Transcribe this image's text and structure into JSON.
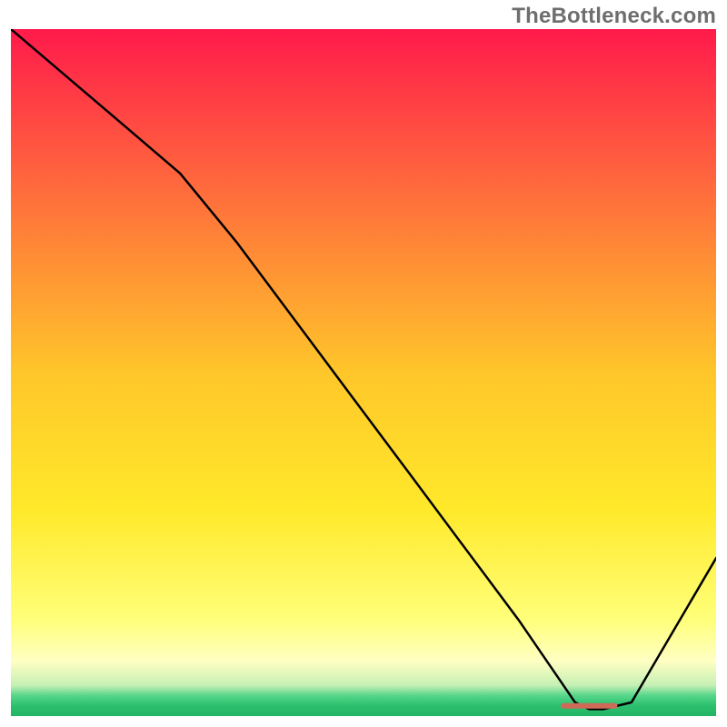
{
  "watermark_text": "TheBottleneck.com",
  "chart_data": {
    "type": "line",
    "title": "",
    "xlabel": "",
    "ylabel": "",
    "xlim": [
      0,
      100
    ],
    "ylim": [
      0,
      100
    ],
    "grid": false,
    "legend": false,
    "annotations": [
      {
        "text": "TheBottleneck.com",
        "position": "top-right"
      }
    ],
    "background": {
      "type": "vertical-gradient",
      "stops": [
        {
          "pos": 0.0,
          "color": "#ff1a4b"
        },
        {
          "pos": 0.25,
          "color": "#ff713b"
        },
        {
          "pos": 0.5,
          "color": "#ffc62a"
        },
        {
          "pos": 0.7,
          "color": "#ffe92a"
        },
        {
          "pos": 0.86,
          "color": "#ffff7a"
        },
        {
          "pos": 0.92,
          "color": "#ffffc3"
        },
        {
          "pos": 0.955,
          "color": "#c6f0b4"
        },
        {
          "pos": 0.97,
          "color": "#57d68a"
        },
        {
          "pos": 0.985,
          "color": "#2bbf6e"
        },
        {
          "pos": 1.0,
          "color": "#23b566"
        }
      ]
    },
    "series": [
      {
        "name": "bottleneck-curve",
        "x": [
          0,
          8,
          16,
          24,
          32,
          40,
          48,
          56,
          64,
          72,
          78,
          80,
          82,
          84,
          88,
          92,
          96,
          100
        ],
        "y": [
          100,
          93,
          86,
          79,
          69,
          58,
          47,
          36,
          25,
          14,
          5,
          2,
          1,
          1,
          2,
          9,
          16,
          23
        ],
        "color": "#000000",
        "width": 2.5
      }
    ],
    "markers": [
      {
        "name": "optimal-range-marker",
        "x_range": [
          78,
          86
        ],
        "y": 1.5,
        "color": "#d06a58"
      }
    ]
  }
}
